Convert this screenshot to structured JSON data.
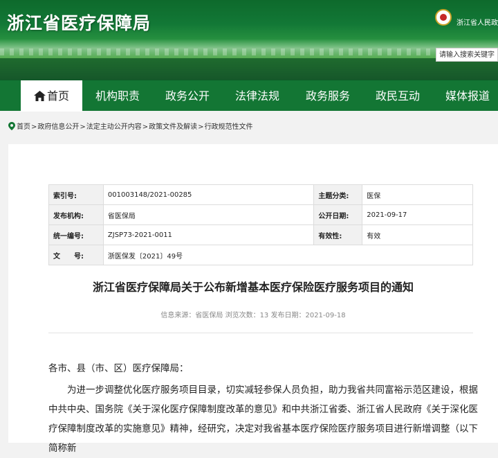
{
  "header": {
    "site_title": "浙江省医疗保障局",
    "gov_name": "浙江省人民政府",
    "search_placeholder": "请输入搜索关键字"
  },
  "nav": {
    "items": [
      {
        "label": "首页",
        "icon": "home-icon",
        "active": true
      },
      {
        "label": "机构职责"
      },
      {
        "label": "政务公开"
      },
      {
        "label": "法律法规"
      },
      {
        "label": "政务服务"
      },
      {
        "label": "政民互动"
      },
      {
        "label": "媒体报道"
      }
    ]
  },
  "breadcrumb": {
    "icon": "location-icon",
    "items": [
      "首页",
      "政府信息公开",
      "法定主动公开内容",
      "政策文件及解读",
      "行政规范性文件"
    ],
    "separator": ">"
  },
  "meta": {
    "rows": [
      {
        "k1": "索引号:",
        "v1": "001003148/2021-00285",
        "k2": "主题分类:",
        "v2": "医保"
      },
      {
        "k1": "发布机构:",
        "v1": "省医保局",
        "k2": "公开日期:",
        "v2": "2021-09-17"
      },
      {
        "k1": "统一编号:",
        "v1": "ZJSP73-2021-0011",
        "k2": "有效性:",
        "v2": "有效"
      },
      {
        "k1": "文　　号:",
        "v1": "浙医保发〔2021〕49号"
      }
    ]
  },
  "document": {
    "title": "浙江省医疗保障局关于公布新增基本医疗保险医疗服务项目的通知",
    "info": "信息来源：省医保局 浏览次数：13 发布日期：2021-09-18",
    "greeting": "各市、县（市、区）医疗保障局：",
    "paragraph1": "为进一步调整优化医疗服务项目目录，切实减轻参保人员负担，助力我省共同富裕示范区建设，根据中共中央、国务院《关于深化医疗保障制度改革的意见》和中共浙江省委、浙江省人民政府《关于深化医疗保障制度改革的实施意见》精神，经研究，决定对我省基本医疗保险医疗服务项目进行新增调整（以下简称新"
  },
  "colors": {
    "nav_green": "#137634",
    "header_green": "#127836"
  }
}
